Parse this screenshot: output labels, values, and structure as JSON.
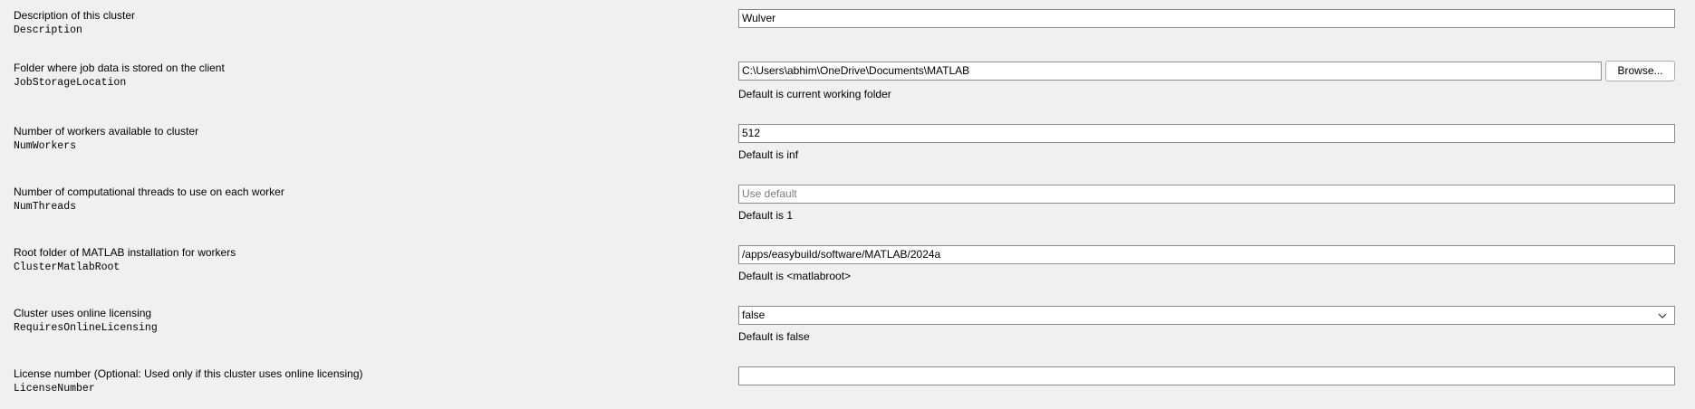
{
  "properties": [
    {
      "description": "Description of this cluster",
      "name": "Description",
      "value": "Wulver",
      "placeholder": "",
      "hint": ""
    },
    {
      "description": "Folder where job data is stored on the client",
      "name": "JobStorageLocation",
      "value": "C:\\Users\\abhim\\OneDrive\\Documents\\MATLAB",
      "placeholder": "",
      "hint": "Default is current working folder",
      "button_label": "Browse..."
    },
    {
      "description": "Number of workers available to cluster",
      "name": "NumWorkers",
      "value": "512",
      "placeholder": "",
      "hint": "Default is inf"
    },
    {
      "description": "Number of computational threads to use on each worker",
      "name": "NumThreads",
      "value": "",
      "placeholder": "Use default",
      "hint": "Default is 1"
    },
    {
      "description": "Root folder of MATLAB installation for workers",
      "name": "ClusterMatlabRoot",
      "value": "/apps/easybuild/software/MATLAB/2024a",
      "placeholder": "",
      "hint": "Default is <matlabroot>"
    },
    {
      "description": "Cluster uses online licensing",
      "name": "RequiresOnlineLicensing",
      "value": "false",
      "placeholder": "",
      "hint": "Default is false",
      "control": "dropdown",
      "icon": "chevron-down-icon"
    },
    {
      "description": "License number (Optional: Used only if this cluster uses online licensing)",
      "name": "LicenseNumber",
      "value": "",
      "placeholder": "",
      "hint": ""
    }
  ]
}
